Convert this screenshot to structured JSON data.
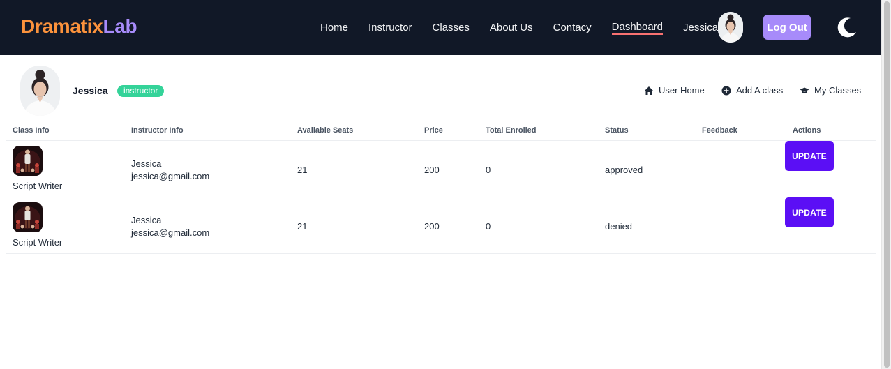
{
  "brand": {
    "part1": "Dramatix",
    "part2": "Lab"
  },
  "nav": {
    "links": [
      {
        "label": "Home"
      },
      {
        "label": "Instructor"
      },
      {
        "label": "Classes"
      },
      {
        "label": "About Us"
      },
      {
        "label": "Contacy"
      },
      {
        "label": "Dashboard",
        "active": true
      },
      {
        "label": "Jessica"
      }
    ],
    "logout_label": "Log Out",
    "theme_icon": "moon-icon"
  },
  "profile": {
    "name": "Jessica",
    "role": "instructor"
  },
  "menu": {
    "user_home": "User Home",
    "add_class": "Add A class",
    "my_classes": "My Classes"
  },
  "table": {
    "headers": {
      "class_info": "Class Info",
      "instructor_info": "Instructor Info",
      "available_seats": "Available Seats",
      "price": "Price",
      "total_enrolled": "Total Enrolled",
      "status": "Status",
      "feedback": "Feedback",
      "actions": "Actions"
    },
    "rows": [
      {
        "class_name": "Script Writer",
        "instructor_name": "Jessica",
        "instructor_email": "jessica@gmail.com",
        "available_seats": "21",
        "price": "200",
        "total_enrolled": "0",
        "status": "approved",
        "feedback": "",
        "action_label": "UPDATE"
      },
      {
        "class_name": "Script Writer",
        "instructor_name": "Jessica",
        "instructor_email": "jessica@gmail.com",
        "available_seats": "21",
        "price": "200",
        "total_enrolled": "0",
        "status": "denied",
        "feedback": "",
        "action_label": "UPDATE"
      }
    ]
  },
  "colors": {
    "navbar_bg": "#111827",
    "brand_orange": "#fb923c",
    "brand_purple": "#a78bfa",
    "badge_green": "#34d399",
    "update_button": "#5b0ff5",
    "active_underline": "#f87171"
  }
}
